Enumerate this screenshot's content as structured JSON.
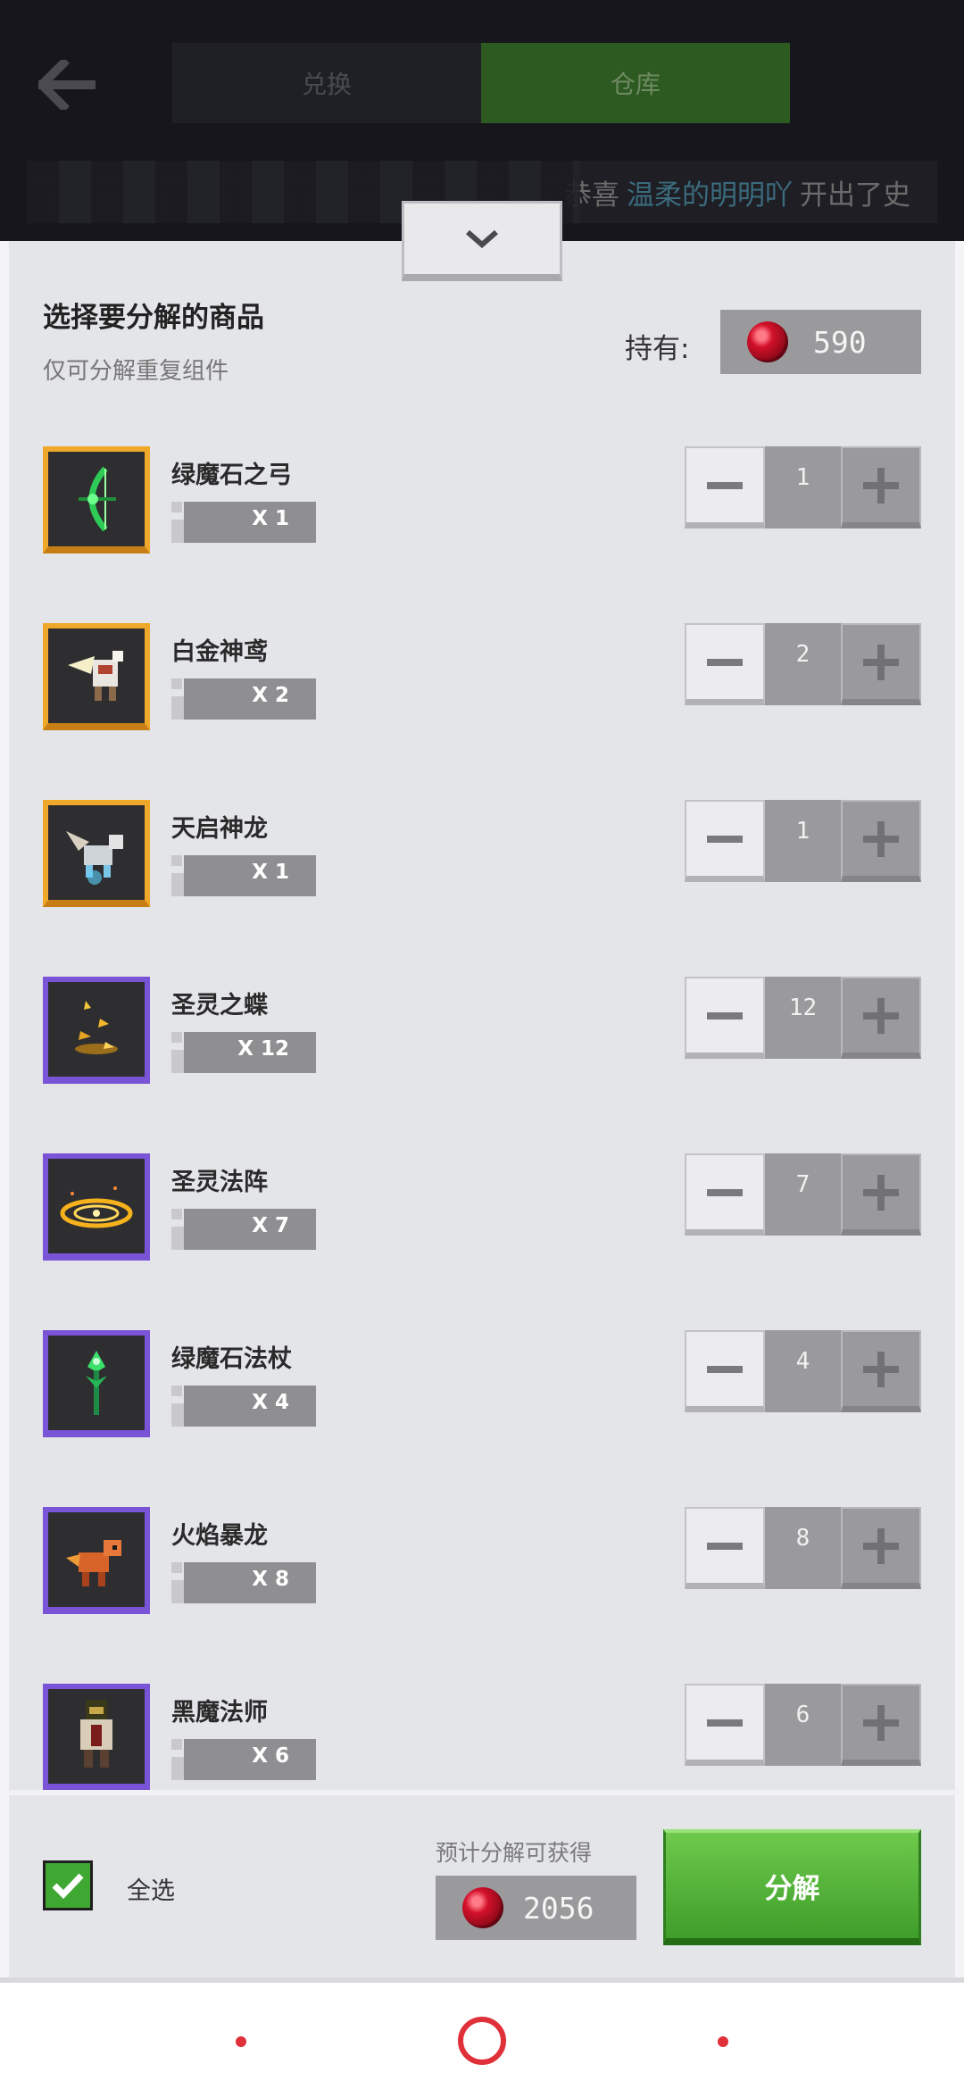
{
  "header": {
    "tabs": [
      {
        "label": "兑换",
        "active": false
      },
      {
        "label": "仓库",
        "active": true
      }
    ],
    "marquee": {
      "prefix": "恭喜",
      "user": "温柔的明明吖",
      "suffix": "开出了史"
    }
  },
  "panel": {
    "title": "选择要分解的商品",
    "subtitle": "仅可分解重复组件",
    "own_label": "持有:",
    "own_value": "590"
  },
  "items": [
    {
      "name": "绿魔石之弓",
      "qty_label": "X 1",
      "count": "1",
      "rarity": "legendary",
      "icon": "green-bow-icon"
    },
    {
      "name": "白金神鸢",
      "qty_label": "X 2",
      "count": "2",
      "rarity": "legendary",
      "icon": "platinum-eagle-icon"
    },
    {
      "name": "天启神龙",
      "qty_label": "X 1",
      "count": "1",
      "rarity": "legendary",
      "icon": "apocalypse-dragon-icon"
    },
    {
      "name": "圣灵之蝶",
      "qty_label": "X 12",
      "count": "12",
      "rarity": "epic",
      "icon": "holy-butterfly-icon"
    },
    {
      "name": "圣灵法阵",
      "qty_label": "X 7",
      "count": "7",
      "rarity": "epic",
      "icon": "holy-magic-circle-icon"
    },
    {
      "name": "绿魔石法杖",
      "qty_label": "X 4",
      "count": "4",
      "rarity": "epic",
      "icon": "green-staff-icon"
    },
    {
      "name": "火焰暴龙",
      "qty_label": "X 8",
      "count": "8",
      "rarity": "epic",
      "icon": "fire-dragon-icon"
    },
    {
      "name": "黑魔法师",
      "qty_label": "X 6",
      "count": "6",
      "rarity": "epic",
      "icon": "dark-mage-icon"
    }
  ],
  "footer": {
    "select_all_label": "全选",
    "select_all_checked": true,
    "estimate_label": "预计分解可获得",
    "estimate_value": "2056",
    "decompose_label": "分解"
  },
  "colors": {
    "legendary": "#f5a623",
    "epic": "#7a54d6",
    "primary_green": "#4caf2f",
    "gem_red": "#d3112b"
  }
}
